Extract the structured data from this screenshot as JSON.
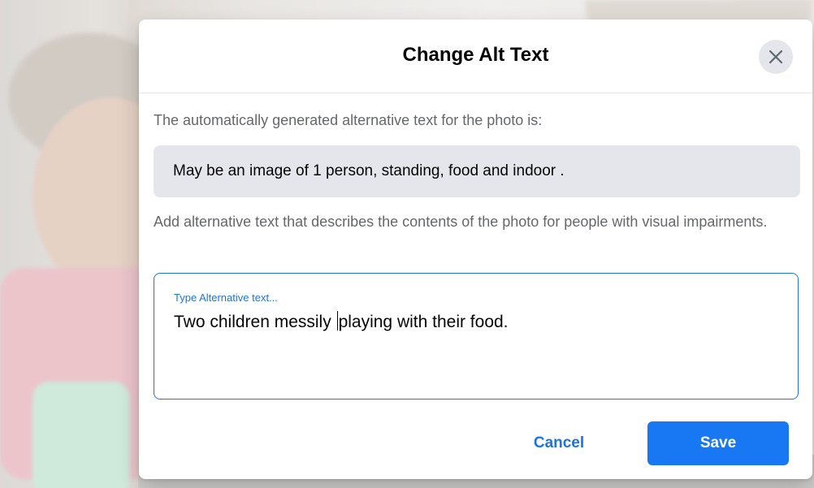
{
  "dialog": {
    "title": "Change Alt Text",
    "close_icon": "close-icon",
    "intro": "The automatically generated alternative text for the photo is:",
    "generated_alt_text": "May be an image of 1 person, standing, food and indoor .",
    "instruction": "Add alternative text that describes the contents of the photo for people with visual impairments.",
    "alt_field": {
      "label": "Type Alternative text...",
      "value_before_caret": "Two children messily ",
      "value_after_caret": "playing with their food."
    },
    "buttons": {
      "cancel": "Cancel",
      "save": "Save"
    }
  },
  "colors": {
    "accent": "#1877f2",
    "link_blue": "#1b74e4",
    "secondary_text": "#65676b",
    "field_bg": "#e4e6eb"
  }
}
